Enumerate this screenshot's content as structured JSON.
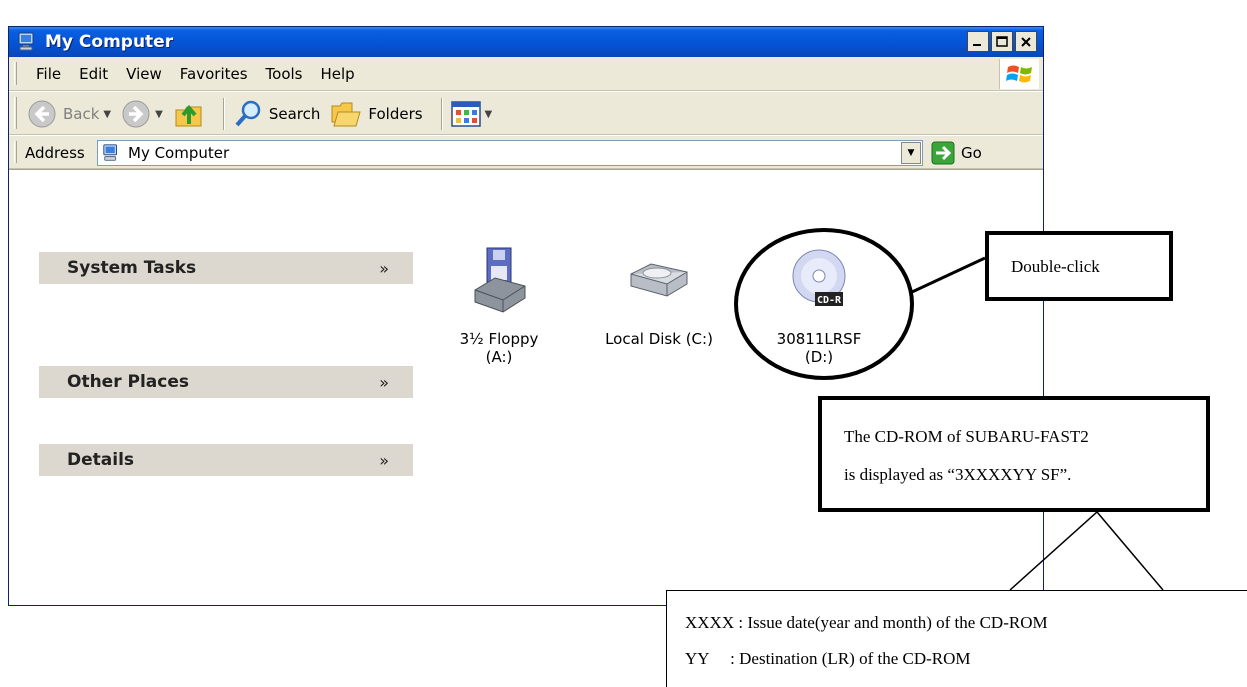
{
  "window": {
    "title": "My Computer",
    "icon": "my-computer-icon",
    "controls": [
      "minimize",
      "maximize",
      "close"
    ]
  },
  "menu": {
    "items": [
      {
        "label": "File",
        "icon": "none"
      },
      {
        "label": "Edit",
        "icon": "none"
      },
      {
        "label": "View",
        "icon": "none"
      },
      {
        "label": "Favorites",
        "icon": "none"
      },
      {
        "label": "Tools",
        "icon": "none"
      },
      {
        "label": "Help",
        "icon": "none"
      }
    ]
  },
  "toolbar": {
    "back_label": "Back",
    "search_label": "Search",
    "folders_label": "Folders"
  },
  "address": {
    "label": "Address",
    "value": "My Computer",
    "go_label": "Go"
  },
  "task_panes": [
    {
      "title": "System Tasks",
      "chevron": "»"
    },
    {
      "title": "Other Places",
      "chevron": "»"
    },
    {
      "title": "Details",
      "chevron": "»"
    }
  ],
  "drives": [
    {
      "line1": "3½ Floppy",
      "line2": "(A:)",
      "icon": "floppy-drive-icon"
    },
    {
      "line1": "Local Disk (C:)",
      "line2": "",
      "icon": "hard-disk-icon"
    },
    {
      "line1": "30811LRSF",
      "line2": "(D:)",
      "icon": "cd-r-icon",
      "badge": "CD-R"
    }
  ],
  "annotations": {
    "double_click": "Double-click",
    "cd_note_line1": "The CD-ROM of SUBARU-FAST2",
    "cd_note_line2": "is displayed as “3XXXXYY SF”.",
    "legend_line1": "XXXX : Issue date(year and month) of the CD-ROM",
    "legend_line2": "YY     : Destination (LR) of the CD-ROM"
  },
  "colors": {
    "titlebar": "#0454d6",
    "chrome": "#ece9d8",
    "task_pane": "#ddd8cf",
    "go_green": "#3aa63a"
  }
}
